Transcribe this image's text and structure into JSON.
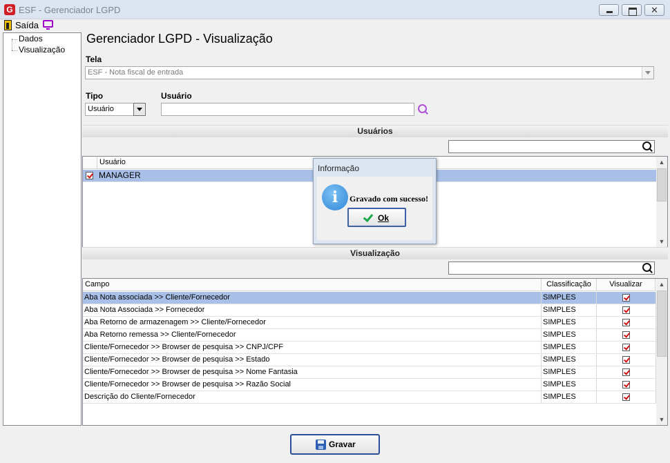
{
  "window": {
    "title": "ESF - Gerenciador LGPD",
    "logo_letter": "G"
  },
  "menu": {
    "exit_label": "Saída"
  },
  "tree": {
    "items": [
      "Dados",
      "Visualização"
    ]
  },
  "page": {
    "title": "Gerenciador LGPD - Visualização"
  },
  "form": {
    "tela_label": "Tela",
    "tela_value": "ESF - Nota fiscal de entrada",
    "tipo_label": "Tipo",
    "tipo_value": "Usuário",
    "usuario_label": "Usuário",
    "usuario_value": ""
  },
  "users_section": {
    "title": "Usuários",
    "column": "Usuário",
    "rows": [
      {
        "checked": true,
        "name": "MANAGER"
      }
    ]
  },
  "view_section": {
    "title": "Visualização",
    "columns": [
      "Campo",
      "Classificação",
      "Visualizar"
    ],
    "rows": [
      {
        "campo": "Aba Nota associada >> Cliente/Fornecedor",
        "classificacao": "SIMPLES",
        "visualizar": true
      },
      {
        "campo": "Aba Nota Associada >> Fornecedor",
        "classificacao": "SIMPLES",
        "visualizar": true
      },
      {
        "campo": "Aba Retorno de armazenagem >>  Cliente/Fornecedor",
        "classificacao": "SIMPLES",
        "visualizar": true
      },
      {
        "campo": "Aba Retorno remessa >> Cliente/Fornecedor",
        "classificacao": "SIMPLES",
        "visualizar": true
      },
      {
        "campo": "Cliente/Fornecedor >> Browser de pesquisa >> CNPJ/CPF",
        "classificacao": "SIMPLES",
        "visualizar": true
      },
      {
        "campo": "Cliente/Fornecedor >> Browser de pesquisa >> Estado",
        "classificacao": "SIMPLES",
        "visualizar": true
      },
      {
        "campo": "Cliente/Fornecedor >> Browser de pesquisa >> Nome Fantasia",
        "classificacao": "SIMPLES",
        "visualizar": true
      },
      {
        "campo": "Cliente/Fornecedor >> Browser de pesquisa >> Razão Social",
        "classificacao": "SIMPLES",
        "visualizar": true
      },
      {
        "campo": "Descrição do Cliente/Fornecedor",
        "classificacao": "SIMPLES",
        "visualizar": true
      }
    ]
  },
  "dialog": {
    "title": "Informação",
    "icon": "i",
    "message": "Gravado com sucesso!",
    "ok_label": "Ok"
  },
  "save_button": {
    "label": "Gravar"
  },
  "colors": {
    "selection": "#a8bfe8",
    "check": "#d01010",
    "ok_check": "#1aa64b",
    "info_icon": "#2d86d8"
  }
}
